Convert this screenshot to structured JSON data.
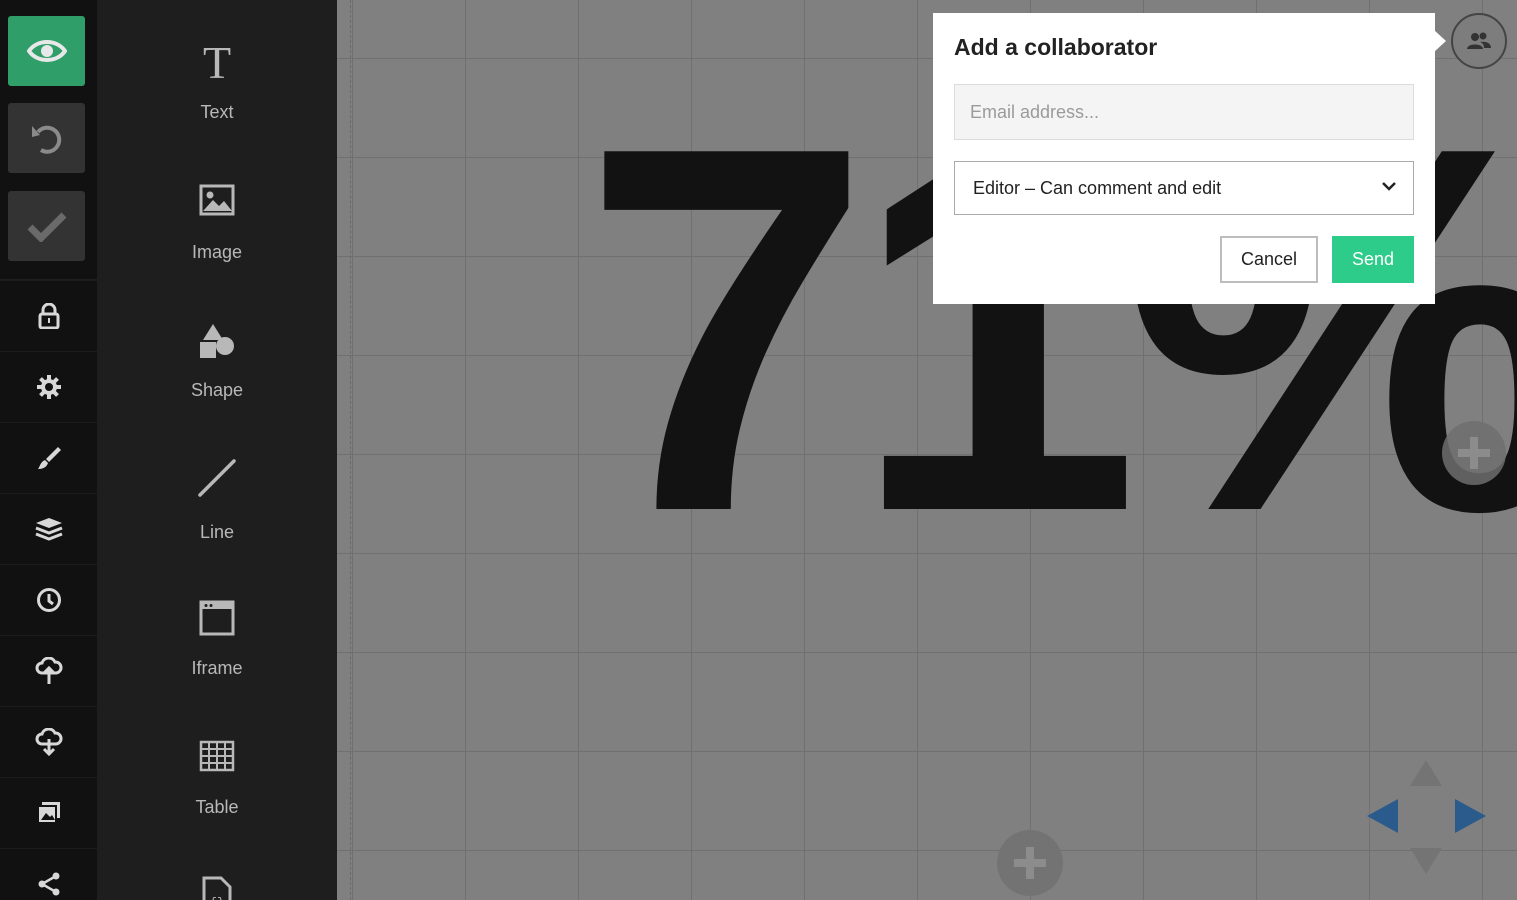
{
  "rail": {
    "items": [
      {
        "name": "preview",
        "icon": "eye-icon"
      },
      {
        "name": "undo",
        "icon": "undo-icon"
      },
      {
        "name": "save",
        "icon": "checkmark-icon"
      },
      {
        "name": "lock",
        "icon": "lock-icon"
      },
      {
        "name": "settings",
        "icon": "gear-icon"
      },
      {
        "name": "style",
        "icon": "brush-icon"
      },
      {
        "name": "layers",
        "icon": "layers-icon"
      },
      {
        "name": "history",
        "icon": "clock-icon"
      },
      {
        "name": "import",
        "icon": "cloud-upload-icon"
      },
      {
        "name": "export",
        "icon": "cloud-download-icon"
      },
      {
        "name": "media",
        "icon": "images-icon"
      },
      {
        "name": "share",
        "icon": "share-icon"
      }
    ],
    "accent": "#2f9e68"
  },
  "tools": {
    "items": [
      {
        "label": "Text",
        "icon": "text-icon"
      },
      {
        "label": "Image",
        "icon": "image-icon"
      },
      {
        "label": "Shape",
        "icon": "shape-icon"
      },
      {
        "label": "Line",
        "icon": "line-icon"
      },
      {
        "label": "Iframe",
        "icon": "iframe-icon"
      },
      {
        "label": "Table",
        "icon": "table-icon"
      },
      {
        "label": "",
        "icon": "code-file-icon"
      }
    ]
  },
  "canvas": {
    "big_text": "71%"
  },
  "dialog": {
    "title": "Add a collaborator",
    "email_placeholder": "Email address...",
    "role_value": "Editor – Can comment and edit",
    "cancel_label": "Cancel",
    "send_label": "Send",
    "send_color": "#2ecc8a"
  },
  "collaborators_button": {
    "icon": "users-icon"
  },
  "navigation": {
    "arrow_color": "#2b5a8c"
  }
}
